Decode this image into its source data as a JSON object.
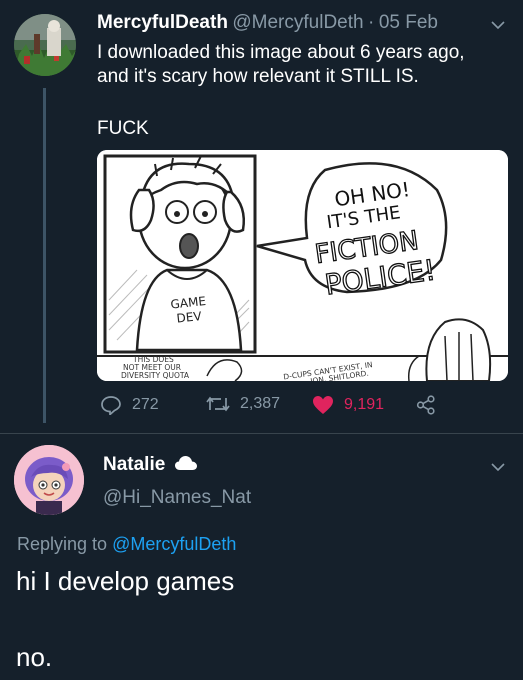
{
  "tweet": {
    "display_name": "MercyfulDeath",
    "handle": "@MercyfulDeth",
    "separator": "·",
    "date": "05 Feb",
    "text_line1": "I downloaded this image about 6 years ago,",
    "text_line2": "and it's scary how relevant it STILL IS.",
    "text_line3": "FUCK",
    "image": {
      "speech_line1": "OH NO!",
      "speech_line2": "IT'S THE",
      "speech_line3": "FICTION",
      "speech_line4": "POLICE!",
      "shirt_line1": "GAME",
      "shirt_line2": "DEV",
      "caption_left_line1": "THIS DOES",
      "caption_left_line2": "NOT MEET OUR",
      "caption_left_line3": "DIVERSITY QUOTA",
      "caption_right_line1": "D-CUPS CAN'T EXIST, IN",
      "caption_right_line2": "...ION, SHITLORD."
    },
    "replies": "272",
    "retweets": "2,387",
    "likes": "9,191"
  },
  "reply_tweet": {
    "display_name": "Natalie",
    "handle": "@Hi_Names_Nat",
    "replying_prefix": "Replying to",
    "replying_to": "@MercyfulDeth",
    "text": "hi I develop games",
    "text2": "no."
  },
  "colors": {
    "background": "#15202b",
    "muted": "#8899a6",
    "link": "#1da1f2",
    "like": "#e0245e"
  },
  "icons": {
    "reply": "comment-icon",
    "retweet": "retweet-icon",
    "like": "heart-icon",
    "share": "share-icon",
    "menu": "chevron-down-icon",
    "badge": "cloud-icon"
  }
}
